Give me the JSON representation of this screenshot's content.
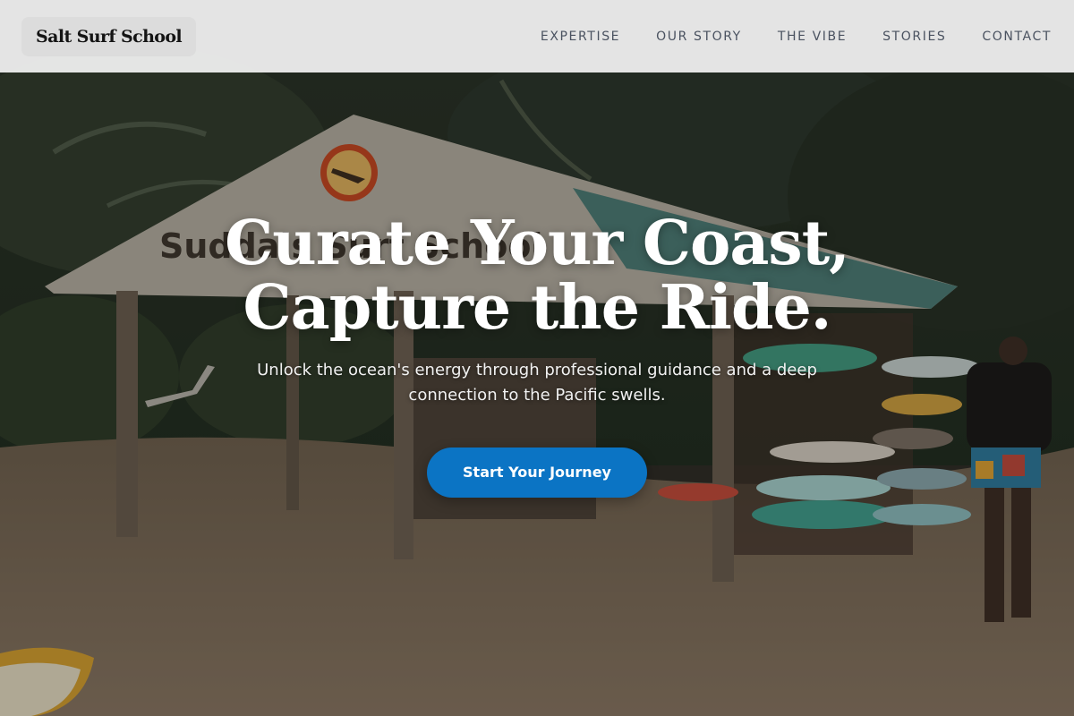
{
  "brand": {
    "name": "Salt Surf School"
  },
  "nav": {
    "items": [
      {
        "label": "EXPERTISE"
      },
      {
        "label": "OUR STORY"
      },
      {
        "label": "THE VIBE"
      },
      {
        "label": "STORIES"
      },
      {
        "label": "CONTACT"
      }
    ]
  },
  "hero": {
    "title_line1": "Curate Your Coast,",
    "title_line2": "Capture the Ride.",
    "subtitle": "Unlock the ocean's energy through professional guidance and a deep connection to the Pacific swells.",
    "cta_label": "Start Your Journey",
    "sign_text": "Suddais Surf School"
  },
  "colors": {
    "nav_bg": "#ececec",
    "cta_bg": "#0b74c4",
    "nav_text": "#4a5260"
  }
}
